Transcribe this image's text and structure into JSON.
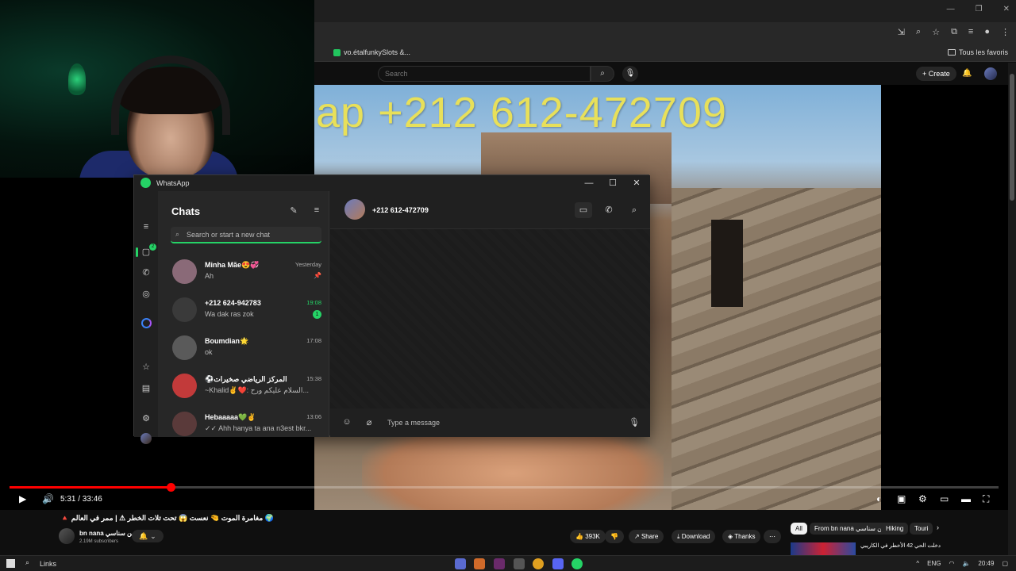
{
  "browser": {
    "bookmark_label": "vo.étalfunkySlots &...",
    "all_favorites": "Tous les favoris"
  },
  "youtube": {
    "search_placeholder": "Search",
    "create_label": "Create",
    "overlay_text": "ap +212 612-472709",
    "time_current": "5:31",
    "time_total": "33:46",
    "time_display": "5:31 / 33:46",
    "progress_fraction": 0.163,
    "video_title": "🔺 مغامرة الموت 🤏 نعست 😱 تحت تلات الخطر ⚠ | ممر في العالم 🌍",
    "channel_name": "bn nana بن سناسي",
    "channel_subs": "2.19M subscribers",
    "likes": "393K",
    "share": "Share",
    "download": "Download",
    "thanks": "Thanks",
    "chips": [
      "All",
      "From bn nana بن سناسي",
      "Hiking",
      "Touri"
    ],
    "suggested_title": "دخلت الحي 42 الأخطر في الكاريبي"
  },
  "whatsapp": {
    "window_title": "WhatsApp",
    "chats_title": "Chats",
    "search_placeholder": "Search or start a new chat",
    "badge_count": "2",
    "chats": [
      {
        "name": "Minha Mãe😍💞",
        "preview": "Ah",
        "time": "Yesterday",
        "pinned": true,
        "unread": "",
        "avatar_color": "#8a6a78"
      },
      {
        "name": "+212 624-942783",
        "preview": "Wa dak ras zok",
        "time": "19:08",
        "pinned": false,
        "unread": "1",
        "avatar_color": "#3a3a3a"
      },
      {
        "name": "Boumdian🌟",
        "preview": "ok",
        "time": "17:08",
        "pinned": false,
        "unread": "",
        "avatar_color": "#5a5a5a"
      },
      {
        "name": "⚽المركز الرياضي صخيرات",
        "preview": "~Khalid✌️❤️: السلام عليكم ورح...",
        "time": "15:38",
        "pinned": false,
        "unread": "",
        "avatar_color": "#c23a3a"
      },
      {
        "name": "Hebaaaaa💚✌️",
        "preview": "✓✓ Ahh hanya ta ana n3est bkr...",
        "time": "13:06",
        "pinned": false,
        "unread": "",
        "avatar_color": "#5a3a3a"
      }
    ],
    "active_chat": "+212 612-472709",
    "message_placeholder": "Type a message"
  },
  "taskbar": {
    "search_label": "Links",
    "language": "ENG",
    "clock": "20:49"
  }
}
